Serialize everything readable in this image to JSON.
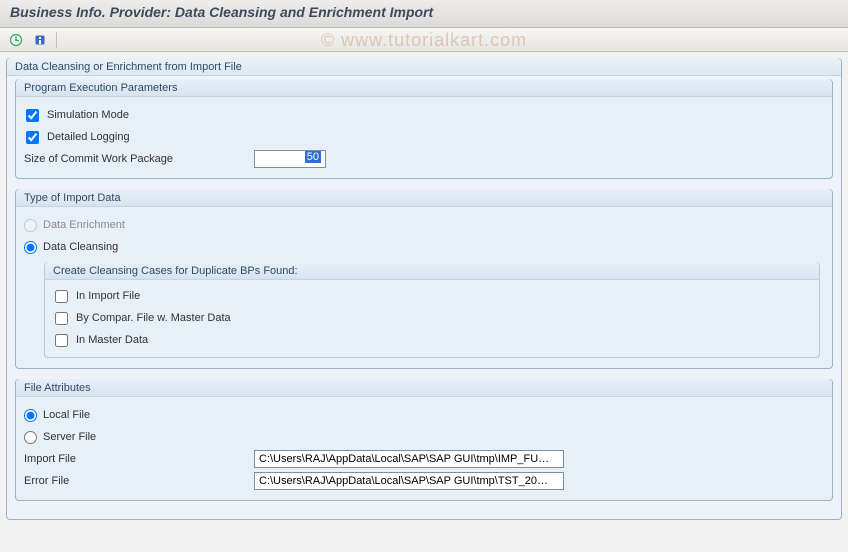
{
  "title": "Business Info. Provider: Data Cleansing and Enrichment Import",
  "watermark": "© www.tutorialkart.com",
  "outerGroup": "Data Cleansing or Enrichment from Import File",
  "params": {
    "legend": "Program Execution Parameters",
    "simulation": "Simulation Mode",
    "detailedLogging": "Detailed Logging",
    "commitLabel": "Size of Commit Work Package",
    "commitValue": "50"
  },
  "importType": {
    "legend": "Type of Import Data",
    "enrichment": "Data Enrichment",
    "cleansing": "Data Cleansing",
    "subLegend": "Create Cleansing Cases for Duplicate BPs Found:",
    "inImportFile": "In Import File",
    "byCompare": "By Compar. File w. Master Data",
    "inMasterData": "In Master Data"
  },
  "fileAttr": {
    "legend": "File Attributes",
    "local": "Local File",
    "server": "Server File",
    "importLabel": "Import File",
    "importValue": "C:\\Users\\RAJ\\AppData\\Local\\SAP\\SAP GUI\\tmp\\IMP_FU…",
    "errorLabel": "Error File",
    "errorValue": "C:\\Users\\RAJ\\AppData\\Local\\SAP\\SAP GUI\\tmp\\TST_20…"
  }
}
